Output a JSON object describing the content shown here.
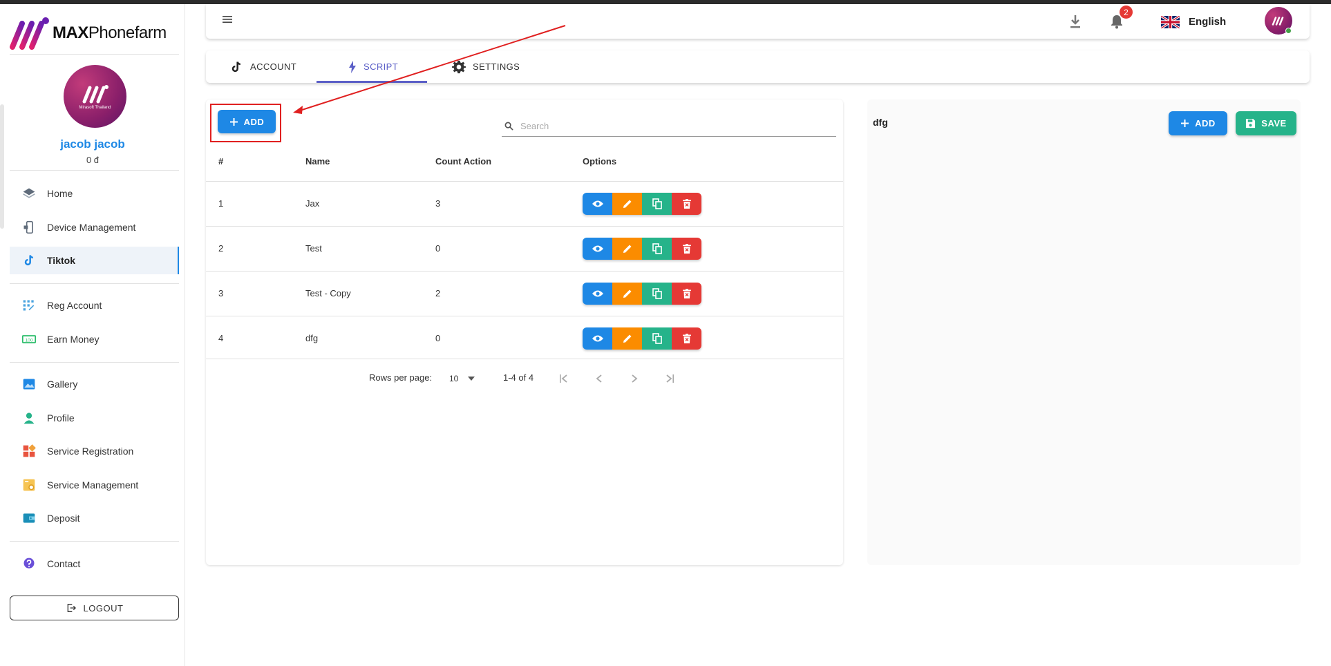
{
  "brand": {
    "name_bold": "MAX",
    "name_rest": "Phonefarm",
    "avatar_caption": "Mirasoft Thailand"
  },
  "user": {
    "name": "jacob jacob",
    "balance": "0 đ"
  },
  "sidebar": {
    "items": [
      {
        "label": "Home",
        "icon": "layers-icon"
      },
      {
        "label": "Device Management",
        "icon": "device-icon"
      },
      {
        "label": "Tiktok",
        "icon": "tiktok-icon",
        "active": true
      },
      {
        "label": "Reg Account",
        "icon": "grid-dots-icon"
      },
      {
        "label": "Earn Money",
        "icon": "money-icon"
      },
      {
        "label": "Gallery",
        "icon": "image-icon"
      },
      {
        "label": "Profile",
        "icon": "person-icon"
      },
      {
        "label": "Service Registration",
        "icon": "widgets-icon"
      },
      {
        "label": "Service Management",
        "icon": "service-icon"
      },
      {
        "label": "Deposit",
        "icon": "wallet-icon"
      },
      {
        "label": "Contact",
        "icon": "help-icon"
      }
    ],
    "logout_label": "LOGOUT"
  },
  "header": {
    "notification_count": "2",
    "language": "English"
  },
  "tabs": [
    {
      "label": "ACCOUNT",
      "icon": "tiktok-icon"
    },
    {
      "label": "SCRIPT",
      "icon": "bolt-icon",
      "active": true
    },
    {
      "label": "SETTINGS",
      "icon": "gear-icon"
    }
  ],
  "scripts": {
    "add_label": "ADD",
    "search_placeholder": "Search",
    "columns": [
      "#",
      "Name",
      "Count Action",
      "Options"
    ],
    "rows": [
      {
        "id": "1",
        "name": "Jax",
        "count": "3"
      },
      {
        "id": "2",
        "name": "Test",
        "count": "0"
      },
      {
        "id": "3",
        "name": "Test - Copy",
        "count": "2"
      },
      {
        "id": "4",
        "name": "dfg",
        "count": "0"
      }
    ],
    "pagination": {
      "rows_per_page_label": "Rows per page:",
      "rows_per_page": "10",
      "range": "1-4 of 4"
    }
  },
  "editor": {
    "title": "dfg",
    "add_label": "ADD",
    "save_label": "SAVE"
  },
  "colors": {
    "primary": "#1e88e5",
    "accent": "#5b5fc7",
    "edit": "#fb8c00",
    "copy": "#26b38a",
    "delete": "#e53935",
    "annotation": "#e02020"
  }
}
